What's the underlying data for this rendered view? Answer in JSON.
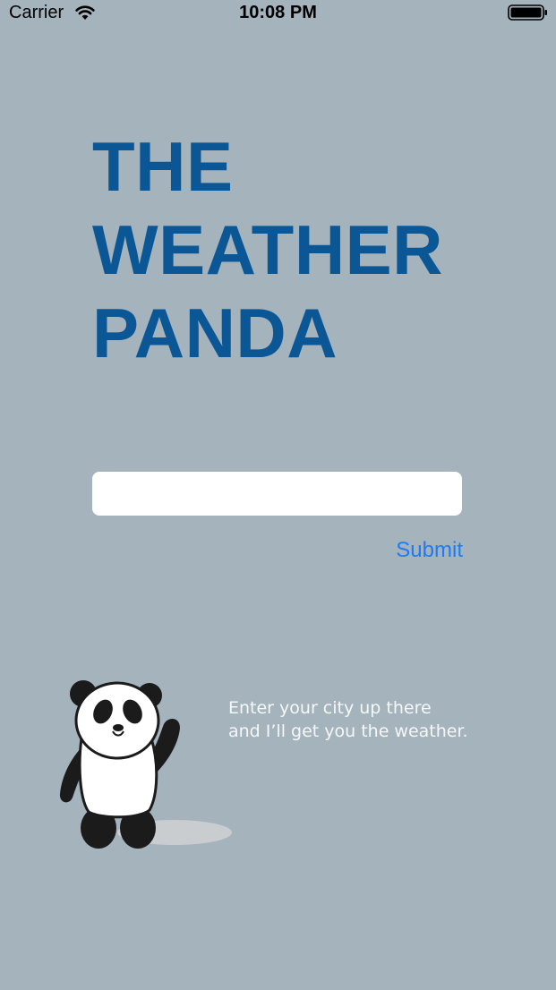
{
  "status_bar": {
    "carrier": "Carrier",
    "time": "10:08 PM"
  },
  "title": {
    "line1": "THE",
    "line2": "WEATHER",
    "line3": "PANDA",
    "color": "#0b5796"
  },
  "city_input": {
    "value": "",
    "placeholder": ""
  },
  "submit_label": "Submit",
  "hint": {
    "line1": "Enter your city up there",
    "line2": "and I’ll get you the weather."
  },
  "colors": {
    "background": "#a5b3bd",
    "accent": "#1f7bef"
  },
  "icons": {
    "wifi": "wifi-icon",
    "battery": "battery-icon",
    "mascot": "panda-illustration"
  }
}
